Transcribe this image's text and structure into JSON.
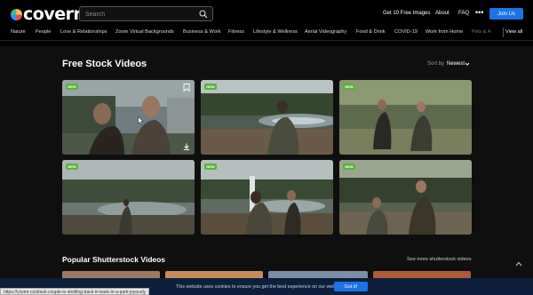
{
  "header": {
    "logo_text": "coverr",
    "search_placeholder": "Search",
    "links": {
      "free_images": "Get 10 Free Images",
      "about": "About",
      "faq": "FAQ"
    },
    "more": "•••",
    "join": "Join Us"
  },
  "categories": [
    "Nature",
    "People",
    "Love & Relationships",
    "Zoom Virtual Backgrounds",
    "Business & Work",
    "Fitness",
    "Lifestyle & Wellness",
    "Aerial Videography",
    "Food & Drink",
    "COVID-19",
    "Work from Home",
    "Pets & A"
  ],
  "view_all": "View all",
  "main": {
    "title": "Free Stock Videos",
    "sort_label": "Sort by",
    "sort_value": "Newest",
    "badge": "NEW",
    "popular_title": "Popular Shutterstock Videos",
    "see_more": "See more shutterstock videos"
  },
  "icons": [
    "coverr-logo-icon",
    "search-icon",
    "more-icon",
    "chevron-down-icon",
    "bookmark-icon",
    "download-icon",
    "cursor-icon",
    "scroll-top-icon"
  ],
  "colors": {
    "accent": "#1a73e8",
    "badge": "#58b33a",
    "cookie_bg": "#0d1f3a"
  },
  "cookie": {
    "text": "This website uses cookies to ensure you get the best experience on our website.",
    "button": "Got it!"
  },
  "status_url": "https://coverr.co/stock-couple-is-strolling-back-in-back-in-a-park-joyously"
}
